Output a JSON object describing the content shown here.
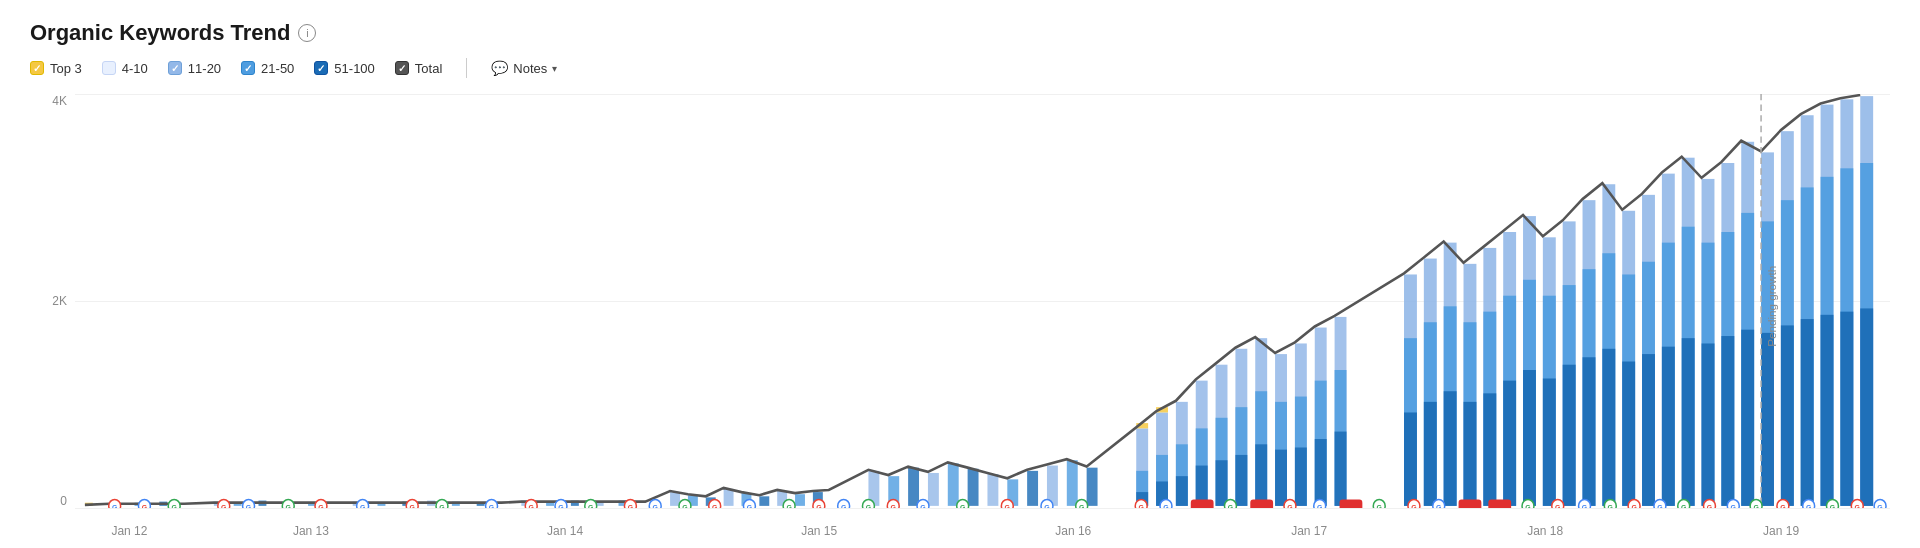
{
  "title": "Organic Keywords Trend",
  "info_icon": "i",
  "legend": {
    "items": [
      {
        "id": "top3",
        "label": "Top 3",
        "checked": true,
        "color_class": "yellow"
      },
      {
        "id": "4-10",
        "label": "4-10",
        "checked": false,
        "color_class": "light-blue-unchecked"
      },
      {
        "id": "11-20",
        "label": "11-20",
        "checked": true,
        "color_class": "light-blue"
      },
      {
        "id": "21-50",
        "label": "21-50",
        "checked": true,
        "color_class": "blue"
      },
      {
        "id": "51-100",
        "label": "51-100",
        "checked": true,
        "color_class": "dark-blue"
      },
      {
        "id": "total",
        "label": "Total",
        "checked": true,
        "color_class": "dark-gray"
      }
    ],
    "notes_label": "Notes"
  },
  "y_axis": {
    "labels": [
      "4K",
      "2K",
      "0"
    ]
  },
  "x_axis": {
    "labels": [
      {
        "text": "Jan 12",
        "pct": 3
      },
      {
        "text": "Jan 13",
        "pct": 13
      },
      {
        "text": "Jan 14",
        "pct": 27
      },
      {
        "text": "Jan 15",
        "pct": 41
      },
      {
        "text": "Jan 16",
        "pct": 55
      },
      {
        "text": "Jan 17",
        "pct": 68
      },
      {
        "text": "Jan 18",
        "pct": 81
      },
      {
        "text": "Jan 19",
        "pct": 94
      }
    ]
  },
  "rotated_label": "Pending growth",
  "colors": {
    "top3": "#f5c842",
    "4_10": "#c5d5f5",
    "11_20": "#93b8e8",
    "21_50": "#4e9de0",
    "51_100": "#1a6bb5",
    "total_line": "#555",
    "dashed_line": "#999",
    "google_red": "#ea4335",
    "google_blue": "#4285f4",
    "google_green": "#34a853",
    "accent_red": "#e03030"
  }
}
